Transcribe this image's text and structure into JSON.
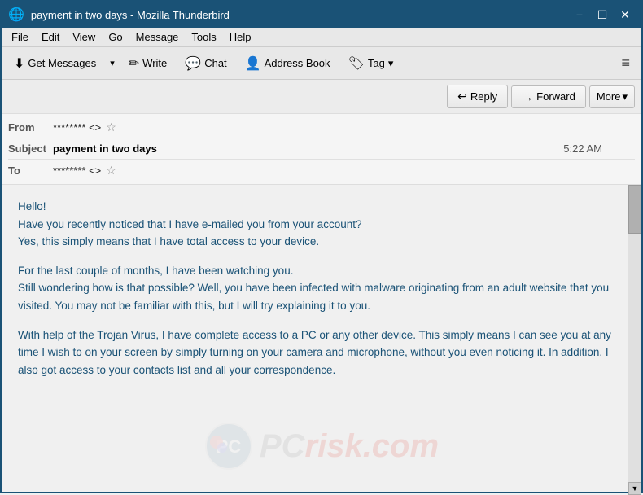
{
  "titlebar": {
    "title": "payment in two days - Mozilla Thunderbird",
    "icon": "🦅",
    "minimize": "−",
    "maximize": "☐",
    "close": "✕"
  },
  "menubar": {
    "items": [
      "File",
      "Edit",
      "View",
      "Go",
      "Message",
      "Tools",
      "Help"
    ]
  },
  "toolbar": {
    "getMessages": "Get Messages",
    "write": "Write",
    "chat": "Chat",
    "addressBook": "Address Book",
    "tag": "Tag",
    "hamburger": "≡"
  },
  "email": {
    "actionButtons": {
      "reply": "Reply",
      "forward": "Forward",
      "more": "More"
    },
    "fields": {
      "fromLabel": "From",
      "fromValue": "******** <>",
      "subjectLabel": "Subject",
      "subjectValue": "payment in two days",
      "time": "5:22 AM",
      "toLabel": "To",
      "toValue": "******** <>"
    },
    "body": {
      "p1": "Hello!\nHave you recently noticed that I have e-mailed you from your account?\nYes, this simply means that I have total access to your device.",
      "p2": "For the last couple of months, I have been watching you.\nStill wondering how is that possible? Well, you have been infected with malware originating from an adult website that you visited. You may not be familiar with this, but I will try explaining it to you.",
      "p3": "With help of the Trojan Virus, I have complete access to a PC or any other device. This simply means I can see you at any time I wish to on your screen by simply turning on your camera and microphone, without you even noticing it. In addition, I also got access to your contacts list and all your correspondence."
    }
  },
  "watermark": {
    "text": "PC",
    "suffix": "risk.com"
  }
}
